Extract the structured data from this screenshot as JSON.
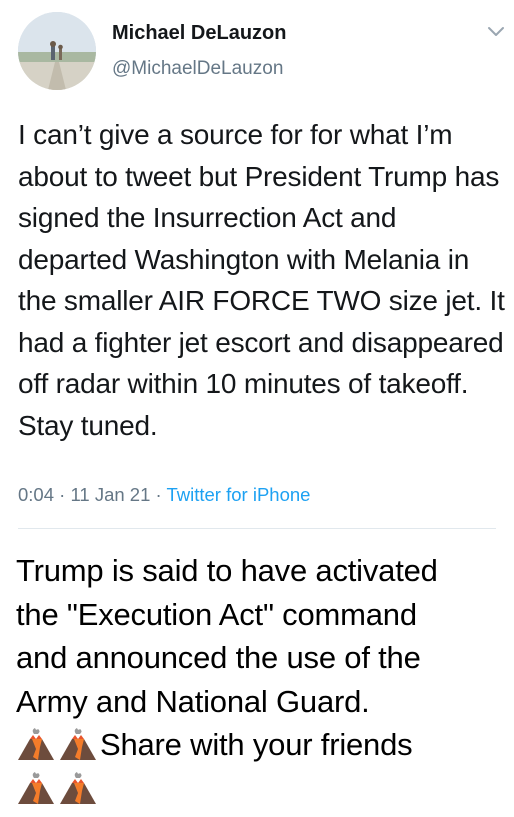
{
  "tweet": {
    "display_name": "Michael DeLauzon",
    "handle": "@MichaelDeLauzon",
    "text": "I can’t give a source for for what I’m about to tweet but President Trump has signed the Insurrection Act and departed Washington with Melania in the smaller AIR FORCE TWO size jet. It had a fighter jet escort and disappeared off radar within 10 minutes of takeoff. Stay tuned.",
    "time": "0:04",
    "date": "11 Jan 21",
    "separator": "·",
    "source": "Twitter for iPhone",
    "menu_icon": "chevron-down-icon",
    "avatar_icon": "profile-photo"
  },
  "caption": {
    "line1": "Trump is said to have activated",
    "line2": "the \"Execution Act\" command",
    "line3": "and announced the use of the",
    "line4": "Army and National Guard.",
    "share_text": "Share with your friends",
    "emoji_icon": "volcano-emoji"
  },
  "colors": {
    "primary_text": "#14171a",
    "secondary_text": "#657786",
    "link": "#1da1f2",
    "divider": "#e1e8ed"
  }
}
